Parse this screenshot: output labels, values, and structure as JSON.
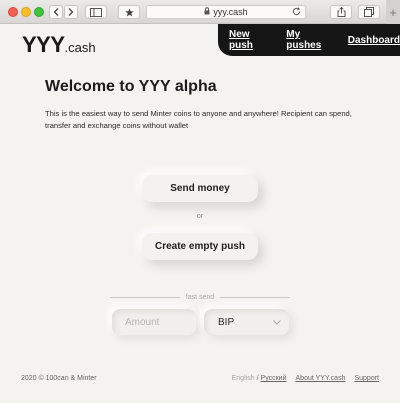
{
  "browser": {
    "url": "yyy.cash",
    "new_tab": "+"
  },
  "site": {
    "logo_main": "YYY",
    "logo_suffix": ".cash"
  },
  "nav": {
    "items": [
      "New push",
      "My pushes",
      "Dashboard"
    ]
  },
  "main": {
    "title": "Welcome to YYY alpha",
    "description": "This is the easiest way to send Minter coins to anyone and anywhere! Recipient can spend, transfer and exchange coins without wallet",
    "send_money": "Send money",
    "or": "or",
    "create_push": "Create empty push"
  },
  "fast_send": {
    "label": "fast send",
    "amount_placeholder": "Amount",
    "coin": "BIP"
  },
  "footer": {
    "copyright": "2020 © 100can & Minter",
    "lang_current": "English",
    "lang_sep": "/",
    "lang_other": "Русский",
    "about": "About YYY.cash",
    "support": "Support"
  }
}
